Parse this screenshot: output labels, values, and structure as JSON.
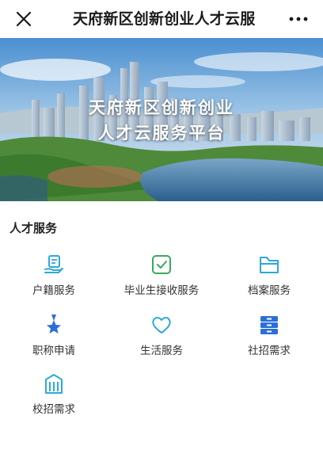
{
  "navbar": {
    "title": "天府新区创新创业人才云服",
    "close_icon": "close-icon",
    "more_icon": "more-dots-icon"
  },
  "banner": {
    "line1": "天府新区创新创业",
    "line2": "人才云服务平台"
  },
  "section": {
    "title": "人才服务"
  },
  "services": [
    {
      "label": "户籍服务",
      "icon": "hand-card-icon"
    },
    {
      "label": "毕业生接收服务",
      "icon": "check-box-icon"
    },
    {
      "label": "档案服务",
      "icon": "folder-icon"
    },
    {
      "label": "职称申请",
      "icon": "star-ribbon-icon"
    },
    {
      "label": "生活服务",
      "icon": "heart-icon"
    },
    {
      "label": "社招需求",
      "icon": "drawer-icon"
    },
    {
      "label": "校招需求",
      "icon": "building-icon"
    }
  ],
  "colors": {
    "icon_accent": "#2ea8d8",
    "icon_green": "#3aa860",
    "icon_blue": "#2a6fd6"
  }
}
